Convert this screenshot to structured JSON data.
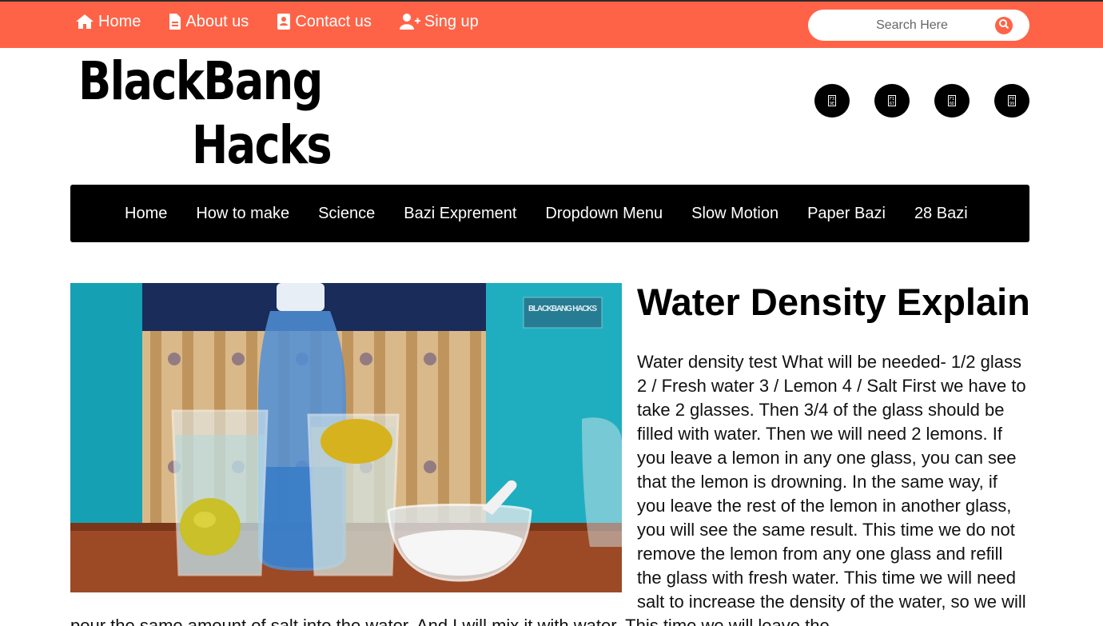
{
  "topbar": {
    "links": [
      {
        "label": "Home",
        "icon": "home-icon"
      },
      {
        "label": "About us",
        "icon": "document-icon"
      },
      {
        "label": "Contact us",
        "icon": "contact-card-icon"
      },
      {
        "label": "Sing up",
        "icon": "add-user-icon"
      }
    ],
    "search_placeholder": "Search Here",
    "accent": "#ff6347"
  },
  "logo": {
    "line1": "BlackBang",
    "line2": "Hacks"
  },
  "socials": [
    {
      "icon": "social-icon-1",
      "glyph": "F3 9E"
    },
    {
      "icon": "social-icon-2",
      "glyph": "F1 67"
    },
    {
      "icon": "social-icon-3",
      "glyph": "F1 6D"
    },
    {
      "icon": "social-icon-4",
      "glyph": "F0 99"
    }
  ],
  "mainnav": [
    "Home",
    "How to make",
    "Science",
    "Bazi Exprement",
    "Dropdown Menu",
    "Slow Motion",
    "Paper Bazi",
    "28 Bazi"
  ],
  "article": {
    "title": "Water Density Explain",
    "image_watermark": "BLACKBANG HACKS",
    "body": "Water density test What will be needed- 1/2 glass 2 / Fresh water 3 / Lemon 4 / Salt First we have to take 2 glasses. Then 3/4 of the glass should be filled with water. Then we will need 2 lemons. If you leave a lemon in any one glass, you can see that the lemon is drowning. In the same way, if you leave the rest of the lemon in another glass, you will see the same result. This time we do not remove the lemon from any one glass and refill the glass with fresh water. This time we will need salt to increase the density of the water, so we will pour the same amount of salt into the water. And I will mix it with water. This time we will leave the"
  }
}
